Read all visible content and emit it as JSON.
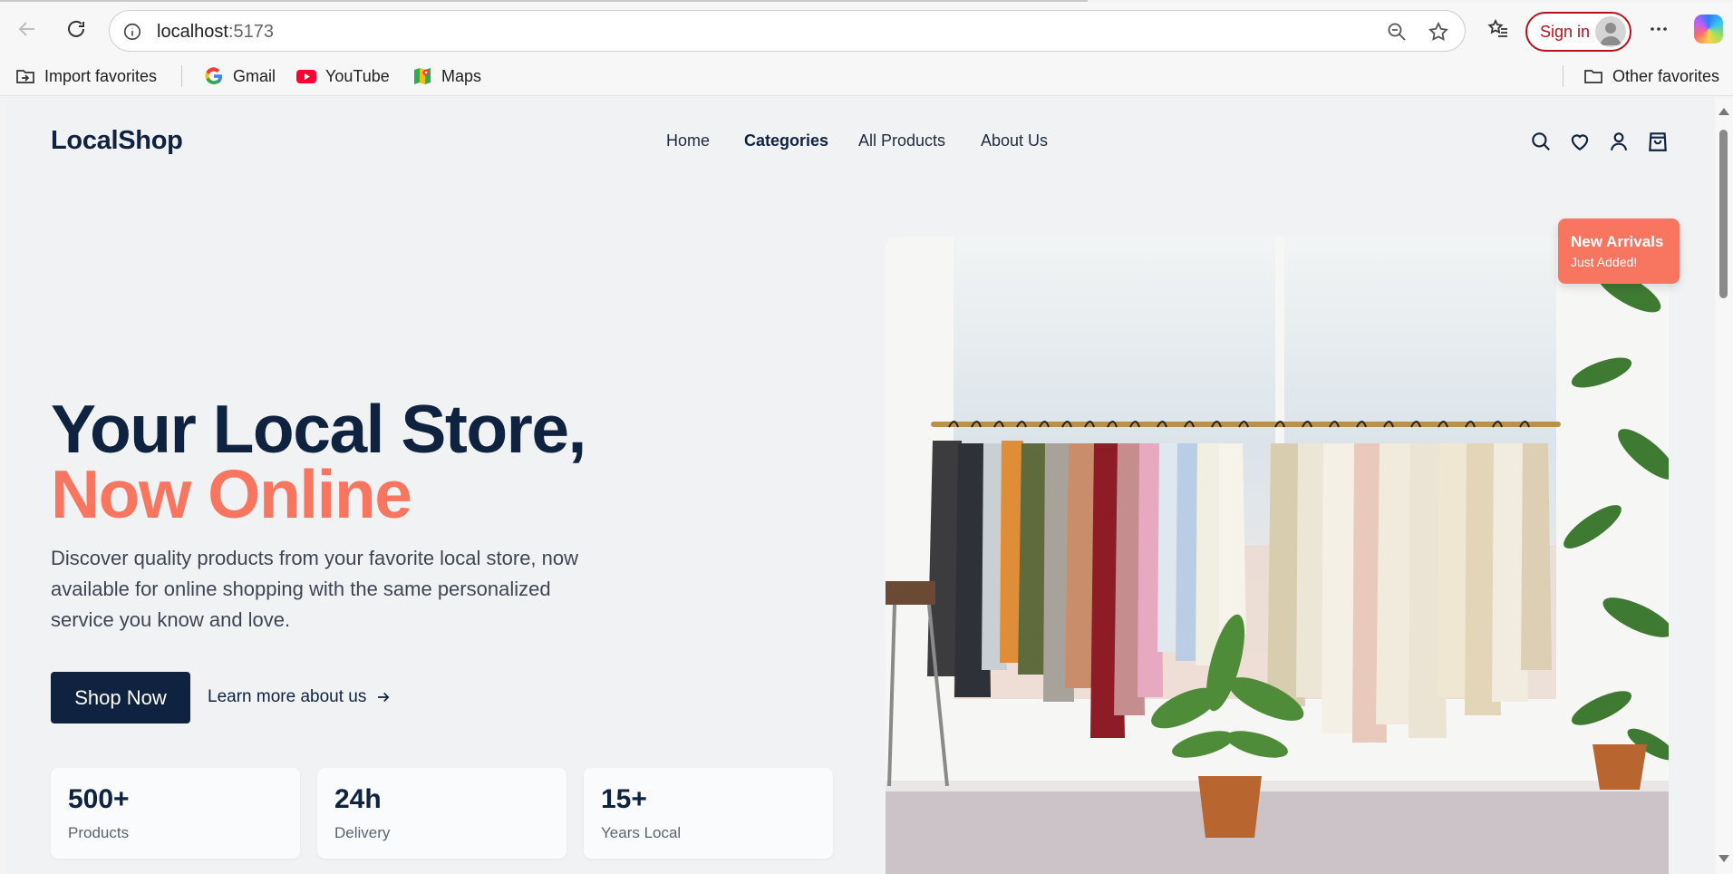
{
  "browser": {
    "url_host": "localhost",
    "url_port": ":5173",
    "sign_in": "Sign in",
    "favorites": [
      {
        "label": "Import favorites",
        "icon": "import-favorites-icon"
      },
      {
        "label": "Gmail",
        "icon": "google-icon"
      },
      {
        "label": "YouTube",
        "icon": "youtube-icon"
      },
      {
        "label": "Maps",
        "icon": "maps-icon"
      }
    ],
    "other_favorites": "Other favorites"
  },
  "site": {
    "logo": "LocalShop",
    "nav": [
      "Home",
      "Categories",
      "All Products",
      "About Us"
    ],
    "header_icons": [
      "search-icon",
      "heart-icon",
      "user-icon",
      "shopping-bag-icon"
    ]
  },
  "hero": {
    "title_line1": "Your Local Store,",
    "title_line2": "Now Online",
    "description": "Discover quality products from your favorite local store, now available for online shopping with the same personalized service you know and love.",
    "primary_cta": "Shop Now",
    "secondary_cta": "Learn more about us",
    "badge_title": "New Arrivals",
    "badge_subtitle": "Just Added!",
    "stats": [
      {
        "value": "500+",
        "label": "Products"
      },
      {
        "value": "24h",
        "label": "Delivery"
      },
      {
        "value": "15+",
        "label": "Years Local"
      }
    ]
  },
  "colors": {
    "navy": "#0f2340",
    "accent": "#f87660",
    "page_bg": "#f1f2f4"
  }
}
